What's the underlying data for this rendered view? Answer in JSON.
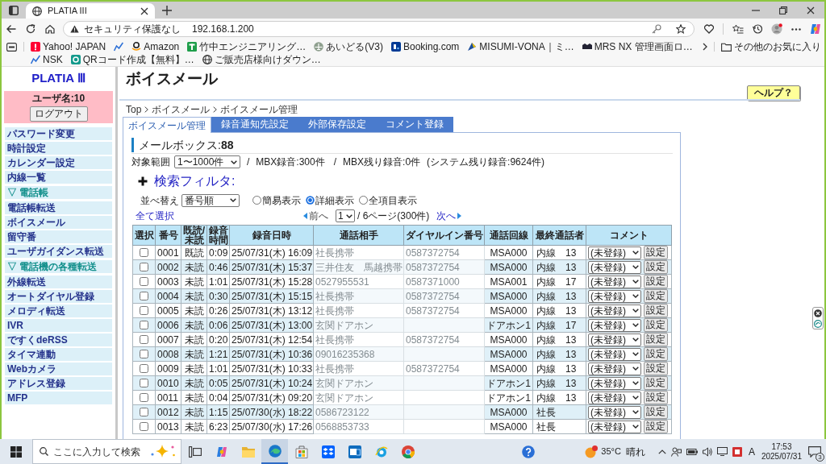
{
  "browser": {
    "tab_title": "PLATIA III",
    "security_label": "セキュリティ保護なし",
    "url": "192.168.1.200",
    "favorites": [
      {
        "kind": "exclaim",
        "label": "Yahoo! JAPAN"
      },
      {
        "kind": "chart"
      },
      {
        "kind": "smile",
        "label": "Amazon"
      },
      {
        "kind": "tee",
        "label": "竹中エンジニアリング…"
      },
      {
        "kind": "plane",
        "label": "あいどる(V3)"
      },
      {
        "kind": "bluetile",
        "label": "Booking.com"
      },
      {
        "kind": "triangle",
        "label": "MISUMI-VONA｜ミ…"
      },
      {
        "kind": "bar",
        "label": "MRS NX 管理画面ロ…"
      },
      {
        "kind": "chart",
        "label": "NSK"
      },
      {
        "kind": "ring",
        "label": "QRコード作成【無料】…"
      },
      {
        "kind": "globe",
        "label": "ご販売店様向けダウン…"
      }
    ],
    "other_favorites": "その他のお気に入り"
  },
  "sidebar": {
    "logo": "PLATIA Ⅲ",
    "user_label": "ユーザ名:10",
    "logout_button": "ログアウト",
    "menu": [
      {
        "kind": "link",
        "label": "パスワード変更"
      },
      {
        "kind": "link",
        "label": "時計設定"
      },
      {
        "kind": "link",
        "label": "カレンダー設定"
      },
      {
        "kind": "link",
        "label": "内線一覧"
      },
      {
        "kind": "section",
        "label": "▽ 電話帳"
      },
      {
        "kind": "link",
        "label": "電話帳転送"
      },
      {
        "kind": "link",
        "label": "ボイスメール"
      },
      {
        "kind": "link",
        "label": "留守番"
      },
      {
        "kind": "link",
        "label": "ユーザガイダンス転送"
      },
      {
        "kind": "section",
        "label": "▽ 電話機の各種転送"
      },
      {
        "kind": "link",
        "label": "外線転送"
      },
      {
        "kind": "link",
        "label": "オートダイヤル登録"
      },
      {
        "kind": "link",
        "label": "メロディ転送"
      },
      {
        "kind": "link",
        "label": "IVR"
      },
      {
        "kind": "link",
        "label": "ですくdeRSS"
      },
      {
        "kind": "link",
        "label": "タイマ連動"
      },
      {
        "kind": "link",
        "label": "Webカメラ"
      },
      {
        "kind": "link",
        "label": "アドレス登録"
      },
      {
        "kind": "link",
        "label": "MFP"
      }
    ]
  },
  "page": {
    "title": "ボイスメール",
    "help_button": "ヘルプ？",
    "breadcrumb": [
      "Top",
      "ボイスメール",
      "ボイスメール管理"
    ],
    "tabs": [
      {
        "label": "ボイスメール管理",
        "selected": true
      },
      {
        "label": "録音通知先設定",
        "selected": false
      },
      {
        "label": "外部保存設定",
        "selected": false
      },
      {
        "label": "コメント登録",
        "selected": false
      }
    ],
    "mailbox_heading": "メールボックス:**88**",
    "range": {
      "label": "対象範囲",
      "value": "1〜1000件",
      "details": [
        {
          "kind": "separator",
          "text": "/"
        },
        {
          "kind": "stat",
          "text": "MBX録音:300件"
        },
        {
          "kind": "separator",
          "text": "/"
        },
        {
          "kind": "stat",
          "text": "MBX残り録音:0件"
        },
        {
          "kind": "stat",
          "text": "(システム残り録音:9624件)"
        }
      ]
    },
    "filter": {
      "label": "検索フィルタ:",
      "expanded": false
    },
    "sort": {
      "label": "並べ替え",
      "value": "番号順"
    },
    "view_modes": [
      {
        "label": "簡易表示",
        "selected": false
      },
      {
        "label": "詳細表示",
        "selected": true
      },
      {
        "label": "全項目表示",
        "selected": false
      }
    ],
    "pagination": {
      "select_all": "全て選択",
      "prev": {
        "label": "前へ",
        "disabled": true
      },
      "page": "1",
      "page_info": "/ 6ページ(300件)",
      "next": {
        "label": "次へ",
        "disabled": false
      }
    }
  },
  "table": {
    "columns": [
      "選択",
      "番号",
      "既読/未読",
      "録音時間",
      "録音日時",
      "通話相手",
      "ダイヤルイン番号",
      "通話回線",
      "最終通話者",
      "コメント"
    ],
    "rows": [
      {
        "checked": false,
        "number": "0001",
        "status": "既読",
        "duration": "0:09",
        "recorded_at": "25/07/31(木) 16:09",
        "caller": "社長携帯",
        "dial_in": "0587372754",
        "line": "MSA000",
        "last_party": "内線　13",
        "comment": "(未登録)",
        "action": "設定"
      },
      {
        "checked": false,
        "number": "0002",
        "status": "未読",
        "duration": "0:46",
        "recorded_at": "25/07/31(木) 15:37",
        "caller": "三井住友　馬越携帯",
        "dial_in": "0587372754",
        "line": "MSA000",
        "last_party": "内線　13",
        "comment": "(未登録)",
        "action": "設定"
      },
      {
        "checked": false,
        "number": "0003",
        "status": "未読",
        "duration": "1:01",
        "recorded_at": "25/07/31(木) 15:28",
        "caller": "0527955531",
        "dial_in": "0587371000",
        "line": "MSA001",
        "last_party": "内線　17",
        "comment": "(未登録)",
        "action": "設定"
      },
      {
        "checked": false,
        "number": "0004",
        "status": "未読",
        "duration": "0:30",
        "recorded_at": "25/07/31(木) 15:15",
        "caller": "社長携帯",
        "dial_in": "0587372754",
        "line": "MSA000",
        "last_party": "内線　13",
        "comment": "(未登録)",
        "action": "設定"
      },
      {
        "checked": false,
        "number": "0005",
        "status": "未読",
        "duration": "0:26",
        "recorded_at": "25/07/31(木) 13:12",
        "caller": "社長携帯",
        "dial_in": "0587372754",
        "line": "MSA000",
        "last_party": "内線　13",
        "comment": "(未登録)",
        "action": "設定"
      },
      {
        "checked": false,
        "number": "0006",
        "status": "未読",
        "duration": "0:06",
        "recorded_at": "25/07/31(木) 13:00",
        "caller": "玄関ドアホン",
        "line": "ドアホン1",
        "last_party": "内線　17",
        "comment": "(未登録)",
        "action": "設定"
      },
      {
        "checked": false,
        "number": "0007",
        "status": "未読",
        "duration": "0:20",
        "recorded_at": "25/07/31(木) 12:54",
        "caller": "社長携帯",
        "dial_in": "0587372754",
        "line": "MSA000",
        "last_party": "内線　13",
        "comment": "(未登録)",
        "action": "設定"
      },
      {
        "checked": false,
        "number": "0008",
        "status": "未読",
        "duration": "1:21",
        "recorded_at": "25/07/31(木) 10:36",
        "caller": "09016235368",
        "line": "MSA000",
        "last_party": "内線　13",
        "comment": "(未登録)",
        "action": "設定"
      },
      {
        "checked": false,
        "number": "0009",
        "status": "未読",
        "duration": "1:01",
        "recorded_at": "25/07/31(木) 10:33",
        "caller": "社長携帯",
        "dial_in": "0587372754",
        "line": "MSA000",
        "last_party": "内線　13",
        "comment": "(未登録)",
        "action": "設定"
      },
      {
        "checked": false,
        "number": "0010",
        "status": "未読",
        "duration": "0:05",
        "recorded_at": "25/07/31(木) 10:24",
        "caller": "玄関ドアホン",
        "line": "ドアホン1",
        "last_party": "内線　13",
        "comment": "(未登録)",
        "action": "設定"
      },
      {
        "checked": false,
        "number": "0011",
        "status": "未読",
        "duration": "0:04",
        "recorded_at": "25/07/31(木) 09:20",
        "caller": "玄関ドアホン",
        "line": "ドアホン1",
        "last_party": "内線　13",
        "comment": "(未登録)",
        "action": "設定"
      },
      {
        "checked": false,
        "number": "0012",
        "status": "未読",
        "duration": "1:15",
        "recorded_at": "25/07/30(水) 18:22",
        "caller": "0586723122",
        "line": "MSA000",
        "last_party": "社長",
        "comment": "(未登録)",
        "action": "設定"
      },
      {
        "checked": false,
        "number": "0013",
        "status": "未読",
        "duration": "6:23",
        "recorded_at": "25/07/30(水) 17:26",
        "caller": "0568853733",
        "line": "MSA000",
        "last_party": "社長",
        "comment": "(未登録)",
        "action": "設定"
      }
    ]
  },
  "taskbar": {
    "search_placeholder": "ここに入力して検索",
    "apps": [
      {
        "kind": "taskview",
        "selected": false
      },
      {
        "kind": "swirl",
        "selected": false
      },
      {
        "kind": "folder",
        "selected": false
      },
      {
        "kind": "wave",
        "selected": true
      },
      {
        "kind": "bag",
        "selected": false
      },
      {
        "kind": "diamond",
        "selected": false
      },
      {
        "kind": "mail",
        "selected": false
      },
      {
        "kind": "orbit",
        "selected": false
      },
      {
        "kind": "wheel",
        "selected": false
      }
    ],
    "weather": {
      "temperature": "35°C",
      "condition": "晴れ"
    },
    "input_indicator": "A",
    "time": "17:53",
    "date": "2025/07/31",
    "notification_count": "3"
  }
}
